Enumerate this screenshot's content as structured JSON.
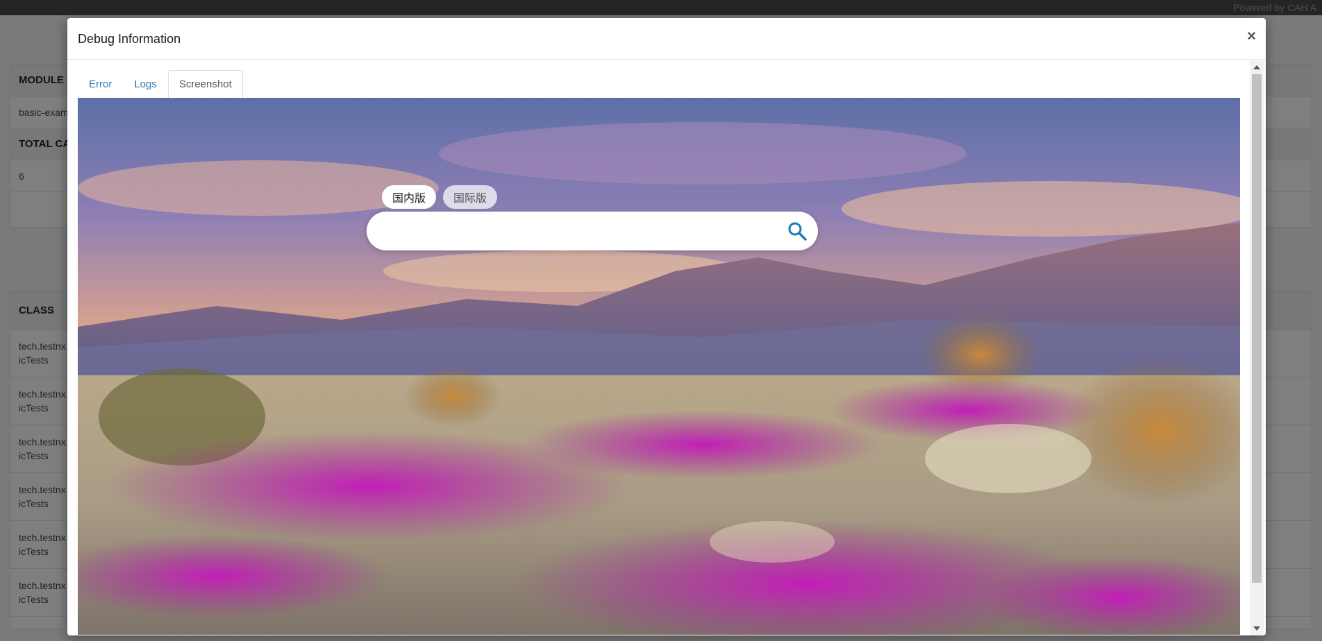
{
  "topbar": {
    "powered": "Powered by CAH A"
  },
  "background_report": {
    "summary": {
      "module_header": "MODULE",
      "module_value": "basic-exam",
      "total_header": "TOTAL CAS",
      "total_value": "6"
    },
    "classes": {
      "header": "CLASS",
      "rows": [
        "tech.testnx\nicTests",
        "tech.testnx\nicTests",
        "tech.testnx\nicTests",
        "tech.testnx\nicTests",
        "tech.testnx\nicTests",
        "tech.testnx\nicTests"
      ]
    }
  },
  "modal": {
    "title": "Debug Information",
    "close": "×",
    "tabs": [
      {
        "label": "Error",
        "active": false
      },
      {
        "label": "Logs",
        "active": false
      },
      {
        "label": "Screenshot",
        "active": true
      }
    ],
    "screenshot": {
      "pill_domestic": "国内版",
      "pill_international": "国际版",
      "search_icon": "search-icon",
      "search_value": ""
    }
  },
  "colors": {
    "tab_link": "#2a7ab8",
    "search_icon": "#1e7bb5",
    "backdrop": "rgba(0,0,0,0.5)"
  }
}
